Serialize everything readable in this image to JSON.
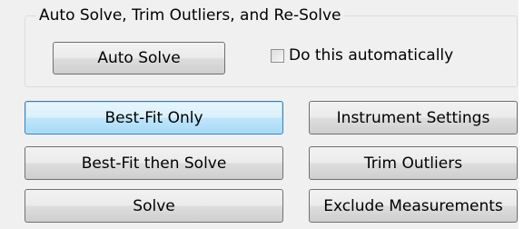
{
  "group": {
    "title": "Auto Solve, Trim Outliers, and Re-Solve",
    "auto_solve_label": "Auto Solve",
    "checkbox_label": "Do this automatically",
    "checkbox_checked": false
  },
  "buttons": {
    "best_fit_only": "Best-Fit Only",
    "best_fit_then_solve": "Best-Fit then Solve",
    "solve": "Solve",
    "instrument_settings": "Instrument Settings",
    "trim_outliers": "Trim Outliers",
    "exclude_measurements": "Exclude Measurements"
  }
}
